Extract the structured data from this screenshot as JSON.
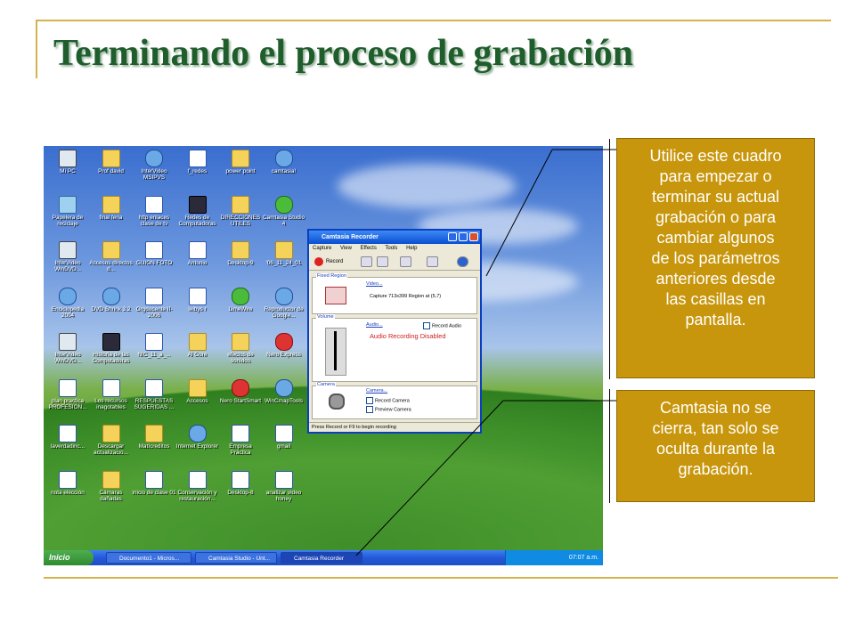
{
  "slide": {
    "title": "Terminando el proceso de grabación",
    "colors": {
      "accent_line": "#d4b24c",
      "title": "#1f5e2c",
      "callout_bg": "#c8960c"
    }
  },
  "desktop": {
    "icons": [
      {
        "label": "Mi PC",
        "icon": "computer-icon"
      },
      {
        "label": "Prof david",
        "icon": "folder-icon"
      },
      {
        "label": "InterVideo MSIPVS",
        "icon": "app-icon"
      },
      {
        "label": "f_redes",
        "icon": "document-icon"
      },
      {
        "label": "power point",
        "icon": "folder-icon"
      },
      {
        "label": "camtasia!",
        "icon": "app-icon"
      },
      {
        "label": "Papelera de reciclaje",
        "icon": "recycle-bin-icon"
      },
      {
        "label": "final feria",
        "icon": "folder-icon"
      },
      {
        "label": "http enlaces clase de tv",
        "icon": "document-icon"
      },
      {
        "label": "Redes de Computadoras",
        "icon": "real-icon"
      },
      {
        "label": "DIRECCIONES UTILES",
        "icon": "folder-icon"
      },
      {
        "label": "Camtasia Studio 4",
        "icon": "green-app-icon"
      },
      {
        "label": "InterVideo WinDVD...",
        "icon": "picture-icon"
      },
      {
        "label": "Accesos directos d...",
        "icon": "folder-icon"
      },
      {
        "label": "GUION FOTO",
        "icon": "document-icon"
      },
      {
        "label": "Antonio",
        "icon": "document-icon"
      },
      {
        "label": "Desktop-9",
        "icon": "folder-icon"
      },
      {
        "label": "'06_11_24_01",
        "icon": "folder-icon"
      },
      {
        "label": "Enciclopedia 2004",
        "icon": "app-icon"
      },
      {
        "label": "DVD Shrink 3.2",
        "icon": "app-icon"
      },
      {
        "label": "Orgdocente II-2006",
        "icon": "document-icon"
      },
      {
        "label": "leibys r",
        "icon": "document-icon"
      },
      {
        "label": "LimeWire",
        "icon": "green-app-icon"
      },
      {
        "label": "Reproductor de Google...",
        "icon": "app-icon"
      },
      {
        "label": "InterVideo WinDVD...",
        "icon": "picture-icon"
      },
      {
        "label": "Historia de las Computadoras",
        "icon": "real-icon"
      },
      {
        "label": "NIC_11_a_...",
        "icon": "document-icon"
      },
      {
        "label": "Al Gore",
        "icon": "folder-icon"
      },
      {
        "label": "efectos de sonidos",
        "icon": "folder-icon"
      },
      {
        "label": "Nero Express",
        "icon": "red-app-icon"
      },
      {
        "label": "plan practica PROFESION...",
        "icon": "document-icon"
      },
      {
        "label": "Los recursos inagotables",
        "icon": "document-icon"
      },
      {
        "label": "RESPUESTAS SUGERIDAS ...",
        "icon": "document-icon"
      },
      {
        "label": "Accesos",
        "icon": "folder-icon"
      },
      {
        "label": "Nero StartSmart",
        "icon": "red-app-icon"
      },
      {
        "label": "WinCmapTools",
        "icon": "app-icon"
      },
      {
        "label": "laverdadinc...",
        "icon": "document-icon"
      },
      {
        "label": "Descargar actualizacio...",
        "icon": "folder-icon"
      },
      {
        "label": "Matícreditos",
        "icon": "folder-icon"
      },
      {
        "label": "Internet Explorer",
        "icon": "app-icon"
      },
      {
        "label": "Empresa Práctica",
        "icon": "document-icon"
      },
      {
        "label": "gmail",
        "icon": "document-icon"
      },
      {
        "label": "nota elección",
        "icon": "document-icon"
      },
      {
        "label": "Cámaras dañadas",
        "icon": "folder-icon"
      },
      {
        "label": "inicio de clase 01",
        "icon": "document-icon"
      },
      {
        "label": "Conservación y restauración...",
        "icon": "document-icon"
      },
      {
        "label": "Desktop-8",
        "icon": "document-icon"
      },
      {
        "label": "analizar video honey",
        "icon": "document-icon"
      }
    ],
    "taskbar": {
      "start_label": "Inicio",
      "tasks": [
        {
          "label": "Documento1 - Micros..."
        },
        {
          "label": "Camtasia Studio - Unt..."
        },
        {
          "label": "Camtasia Recorder"
        }
      ],
      "clock": "07:07 a.m."
    }
  },
  "recorder": {
    "title": "Camtasia Recorder",
    "menu": [
      "Capture",
      "View",
      "Effects",
      "Tools",
      "Help"
    ],
    "record_label": "Record",
    "fixed_region_label": "Fixed Region",
    "video_link": "Video...",
    "capture_text": "Capture 713x399 Region at (5,7)",
    "volume_label": "Volume",
    "audio_link": "Audio...",
    "record_audio_label": "Record Audio",
    "audio_disabled_text": "Audio Recording Disabled",
    "camera_label": "Camera",
    "camera_link": "Camera...",
    "record_camera_label": "Record Camera",
    "preview_camera_label": "Preview Camera",
    "status": "Press Record or F9 to begin recording"
  },
  "callouts": {
    "top": [
      "Utilice este cuadro",
      "para empezar o",
      "terminar su actual",
      "grabación o para",
      "cambiar algunos",
      "de los parámetros",
      "anteriores desde",
      "las casillas en",
      "pantalla."
    ],
    "bottom": [
      "Camtasia no se",
      "cierra, tan solo se",
      "oculta durante la",
      "grabación."
    ]
  }
}
